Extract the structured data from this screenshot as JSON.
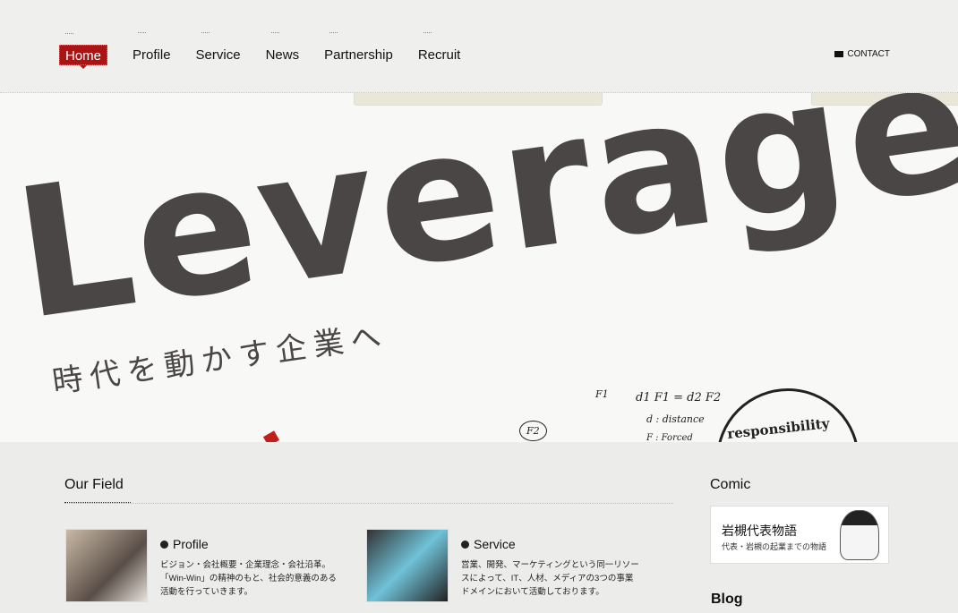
{
  "nav": {
    "items": [
      "Home",
      "Profile",
      "Service",
      "News",
      "Partnership",
      "Recruit"
    ],
    "contact": "CONTACT"
  },
  "hero": {
    "title": "Leverages",
    "subtitle": "時代を動かす企業へ",
    "formula": "d1 F1 = d2 F2",
    "f1": "F1",
    "f2": "F2",
    "distance": "d : distance",
    "forced": "F : Forced",
    "circle": "responsibility"
  },
  "field": {
    "heading": "Our Field",
    "cards": [
      {
        "title": "Profile",
        "desc": "ビジョン・会社概要・企業理念・会社沿革。「Win-Win」の精神のもと、社会的意義のある活動を行っていきます。"
      },
      {
        "title": "Service",
        "desc": "営業、開発、マーケティングという同一リソースによって、IT、人材、メディアの3つの事業ドメインにおいて活動しております。"
      }
    ]
  },
  "comic": {
    "heading": "Comic",
    "title": "岩槻代表物語",
    "subtitle": "代表・岩槻の起業までの物語"
  },
  "blog": {
    "heading": "Blog"
  }
}
